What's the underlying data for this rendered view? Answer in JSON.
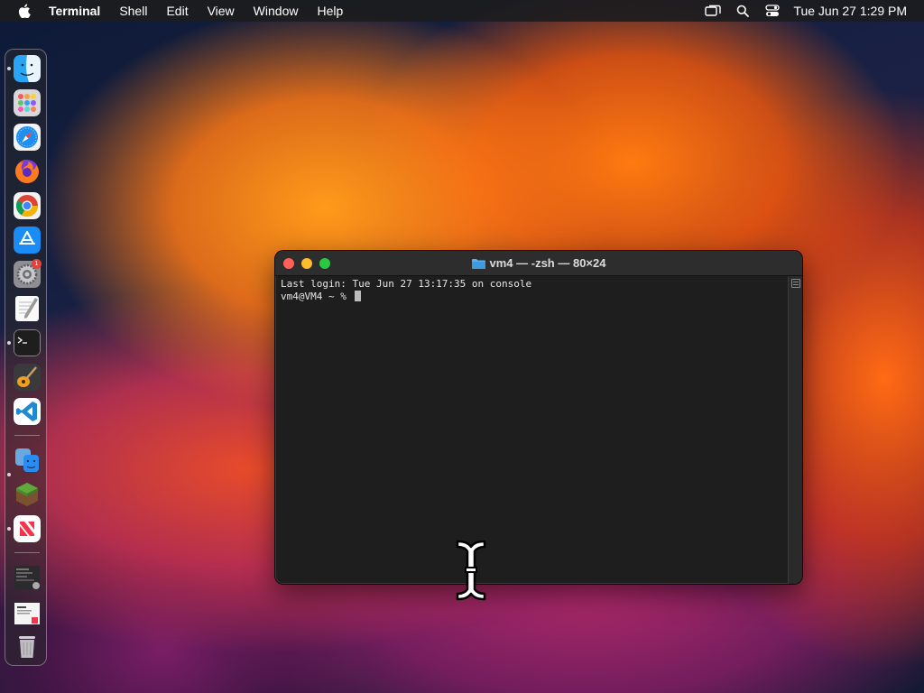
{
  "menubar": {
    "app_name": "Terminal",
    "items": [
      "Shell",
      "Edit",
      "View",
      "Window",
      "Help"
    ],
    "clock": "Tue Jun 27  1:29 PM",
    "icons": [
      "apple-icon",
      "screen-mirroring-icon",
      "spotlight-search-icon",
      "control-center-icon"
    ]
  },
  "dock": {
    "apps": [
      {
        "name": "finder",
        "icon": "finder-icon"
      },
      {
        "name": "launchpad",
        "icon": "launchpad-icon"
      },
      {
        "name": "safari",
        "icon": "safari-icon"
      },
      {
        "name": "firefox",
        "icon": "firefox-icon"
      },
      {
        "name": "chrome",
        "icon": "chrome-icon"
      },
      {
        "name": "app-store",
        "icon": "app-store-icon"
      },
      {
        "name": "system-settings",
        "icon": "settings-icon",
        "badge": "1"
      },
      {
        "name": "textedit",
        "icon": "textedit-icon"
      },
      {
        "name": "terminal",
        "icon": "terminal-icon"
      },
      {
        "name": "garageband",
        "icon": "guitar-icon"
      },
      {
        "name": "vscode",
        "icon": "vscode-icon"
      },
      {
        "name": "migration-assistant",
        "icon": "migration-icon"
      },
      {
        "name": "minecraft",
        "icon": "minecraft-icon"
      },
      {
        "name": "news",
        "icon": "news-icon"
      },
      {
        "name": "recent-screenshot",
        "icon": "screenshot-thumb-icon"
      },
      {
        "name": "recent-document",
        "icon": "document-thumb-icon"
      },
      {
        "name": "trash",
        "icon": "trash-icon"
      }
    ]
  },
  "terminal": {
    "title": "vm4 — -zsh — 80×24",
    "lines": [
      "Last login: Tue Jun 27 13:17:35 on console",
      "vm4@VM4 ~ % "
    ]
  },
  "colors": {
    "close": "#ff5f57",
    "minimize": "#febc2e",
    "maximize": "#28c840",
    "terminal_bg": "#1e1e1e"
  }
}
